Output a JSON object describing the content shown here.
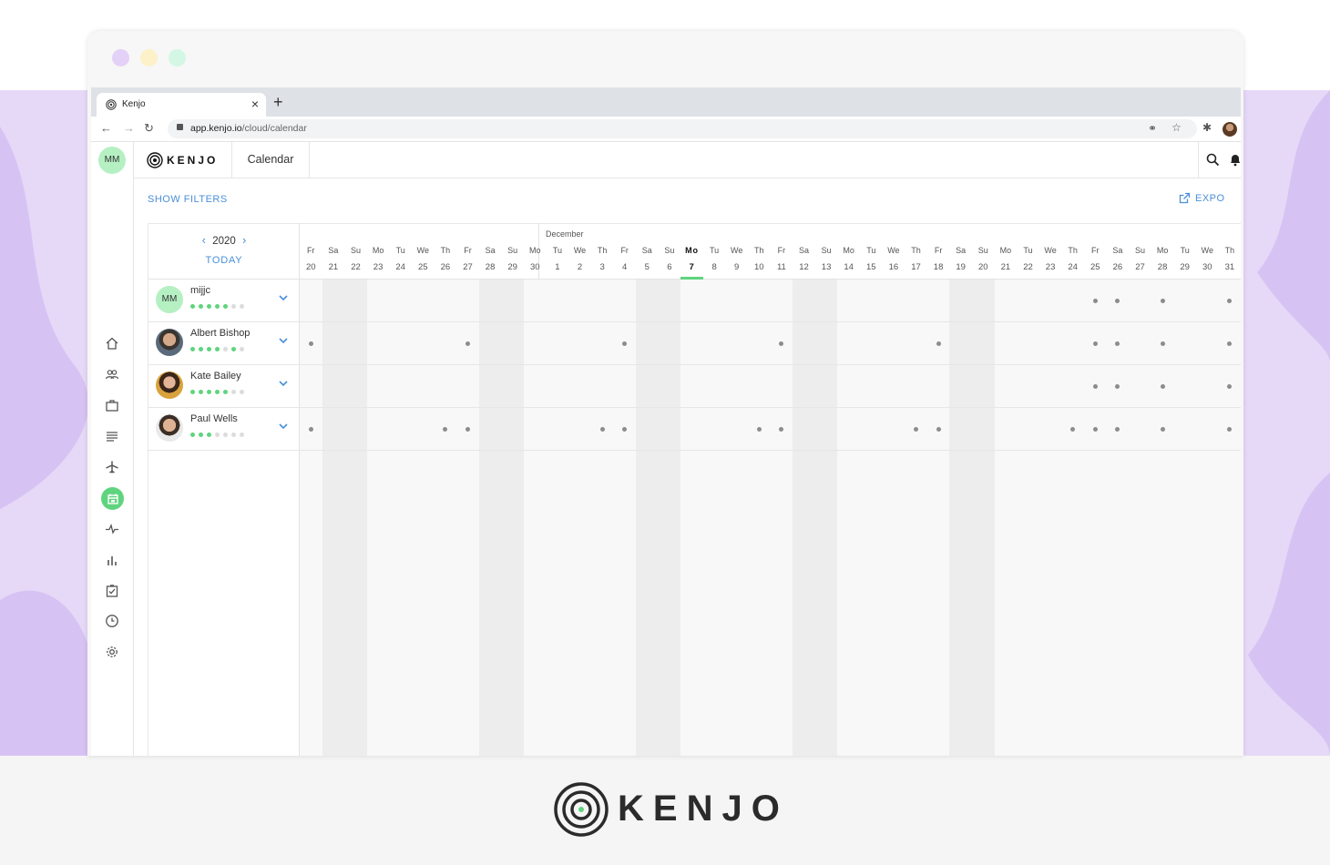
{
  "browser": {
    "tab_title": "Kenjo",
    "new_tab_symbol": "+",
    "close_symbol": "×",
    "url_host": "app.kenjo.io",
    "url_path": "/cloud/calendar",
    "traffic_colors": [
      "#e3d1f7",
      "#fcf1c9",
      "#d3f7e4"
    ]
  },
  "app": {
    "user_initials": "MM",
    "logo_text": "KENJO",
    "module_title": "Calendar",
    "sidebar_icons": [
      "home-icon",
      "people-icon",
      "briefcase-icon",
      "list-icon",
      "airplane-icon",
      "calendar-icon",
      "pulse-icon",
      "bar-chart-icon",
      "checklist-icon",
      "clock-icon",
      "gear-icon"
    ],
    "active_sidebar_item": "calendar-icon",
    "show_filters": "SHOW FILTERS",
    "export": "EXPO"
  },
  "calendar": {
    "year": "2020",
    "today_label": "TODAY",
    "month_label": "December",
    "today_index": 17,
    "weekend_indices": [
      1,
      2,
      8,
      9,
      15,
      16,
      22,
      23,
      29,
      30
    ],
    "days": [
      {
        "w": "Fr",
        "d": "20"
      },
      {
        "w": "Sa",
        "d": "21"
      },
      {
        "w": "Su",
        "d": "22"
      },
      {
        "w": "Mo",
        "d": "23"
      },
      {
        "w": "Tu",
        "d": "24"
      },
      {
        "w": "We",
        "d": "25"
      },
      {
        "w": "Th",
        "d": "26"
      },
      {
        "w": "Fr",
        "d": "27"
      },
      {
        "w": "Sa",
        "d": "28"
      },
      {
        "w": "Su",
        "d": "29"
      },
      {
        "w": "Mo",
        "d": "30"
      },
      {
        "w": "Tu",
        "d": "1"
      },
      {
        "w": "We",
        "d": "2"
      },
      {
        "w": "Th",
        "d": "3"
      },
      {
        "w": "Fr",
        "d": "4"
      },
      {
        "w": "Sa",
        "d": "5"
      },
      {
        "w": "Su",
        "d": "6"
      },
      {
        "w": "Mo",
        "d": "7"
      },
      {
        "w": "Tu",
        "d": "8"
      },
      {
        "w": "We",
        "d": "9"
      },
      {
        "w": "Th",
        "d": "10"
      },
      {
        "w": "Fr",
        "d": "11"
      },
      {
        "w": "Sa",
        "d": "12"
      },
      {
        "w": "Su",
        "d": "13"
      },
      {
        "w": "Mo",
        "d": "14"
      },
      {
        "w": "Tu",
        "d": "15"
      },
      {
        "w": "We",
        "d": "16"
      },
      {
        "w": "Th",
        "d": "17"
      },
      {
        "w": "Fr",
        "d": "18"
      },
      {
        "w": "Sa",
        "d": "19"
      },
      {
        "w": "Su",
        "d": "20"
      },
      {
        "w": "Mo",
        "d": "21"
      },
      {
        "w": "Tu",
        "d": "22"
      },
      {
        "w": "We",
        "d": "23"
      },
      {
        "w": "Th",
        "d": "24"
      },
      {
        "w": "Fr",
        "d": "25"
      },
      {
        "w": "Sa",
        "d": "26"
      },
      {
        "w": "Su",
        "d": "27"
      },
      {
        "w": "Mo",
        "d": "28"
      },
      {
        "w": "Tu",
        "d": "29"
      },
      {
        "w": "We",
        "d": "30"
      },
      {
        "w": "Th",
        "d": "31"
      }
    ],
    "employees": [
      {
        "name": "mijjc",
        "initials": "MM",
        "avatar": "initials",
        "dots_filled": 5,
        "dots_total": 7,
        "marks": [
          35,
          36,
          38,
          41
        ]
      },
      {
        "name": "Albert Bishop",
        "avatar": "photo-1",
        "dots_filled": 5,
        "dots_total": 7,
        "dots_gap_after": 4,
        "marks": [
          0,
          7,
          14,
          21,
          28,
          35,
          36,
          38,
          41
        ]
      },
      {
        "name": "Kate Bailey",
        "avatar": "photo-2",
        "dots_filled": 5,
        "dots_total": 7,
        "marks": [
          35,
          36,
          38,
          41
        ]
      },
      {
        "name": "Paul Wells",
        "avatar": "photo-3",
        "dots_filled": 3,
        "dots_total": 7,
        "marks": [
          0,
          6,
          7,
          13,
          14,
          20,
          21,
          27,
          28,
          34,
          35,
          36,
          38,
          41
        ]
      }
    ]
  },
  "footer": {
    "brand_text": "KENJO"
  },
  "colors": {
    "accent_blue": "#4a8fd8",
    "accent_green": "#5fd47e",
    "avatar_green": "#b5f0c3",
    "weekend_shade": "#ededed",
    "weekday_shade": "#f8f8f8",
    "background_purple": "#e6d9f7"
  }
}
